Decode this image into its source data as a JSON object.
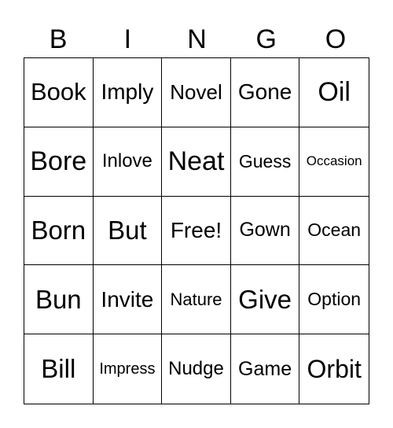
{
  "header": [
    "B",
    "I",
    "N",
    "G",
    "O"
  ],
  "cells": [
    [
      "Book",
      "Imply",
      "Novel",
      "Gone",
      "Oil"
    ],
    [
      "Bore",
      "Inlove",
      "Neat",
      "Guess",
      "Occasion"
    ],
    [
      "Born",
      "But",
      "Free!",
      "Gown",
      "Ocean"
    ],
    [
      "Bun",
      "Invite",
      "Nature",
      "Give",
      "Option"
    ],
    [
      "Bill",
      "Impress",
      "Nudge",
      "Game",
      "Orbit"
    ]
  ]
}
